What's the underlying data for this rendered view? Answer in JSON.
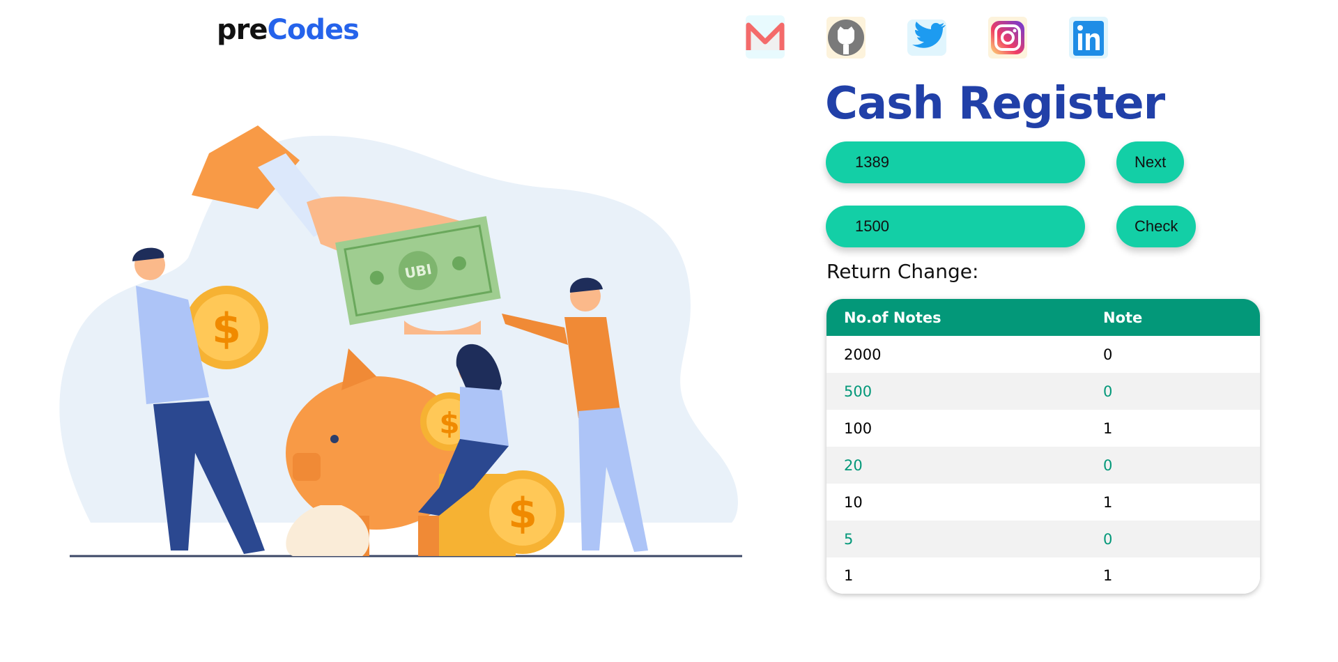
{
  "logo": {
    "part1": "pre",
    "part2": "Codes"
  },
  "social": [
    {
      "name": "gmail"
    },
    {
      "name": "github"
    },
    {
      "name": "twitter"
    },
    {
      "name": "instagram"
    },
    {
      "name": "linkedin"
    }
  ],
  "title": "Cash Register",
  "bill_input": {
    "value": "1389"
  },
  "next_label": "Next",
  "cash_input": {
    "value": "1500"
  },
  "check_label": "Check",
  "return_label": "Return Change:",
  "table": {
    "headers": [
      "No.of Notes",
      "Note"
    ],
    "rows": [
      [
        "2000",
        "0"
      ],
      [
        "500",
        "0"
      ],
      [
        "100",
        "1"
      ],
      [
        "20",
        "0"
      ],
      [
        "10",
        "1"
      ],
      [
        "5",
        "0"
      ],
      [
        "1",
        "1"
      ]
    ]
  },
  "illustration": {
    "bill_text": "UBI"
  },
  "colors": {
    "accent": "#13cfa6",
    "header": "#039879",
    "title": "#2140a8"
  }
}
